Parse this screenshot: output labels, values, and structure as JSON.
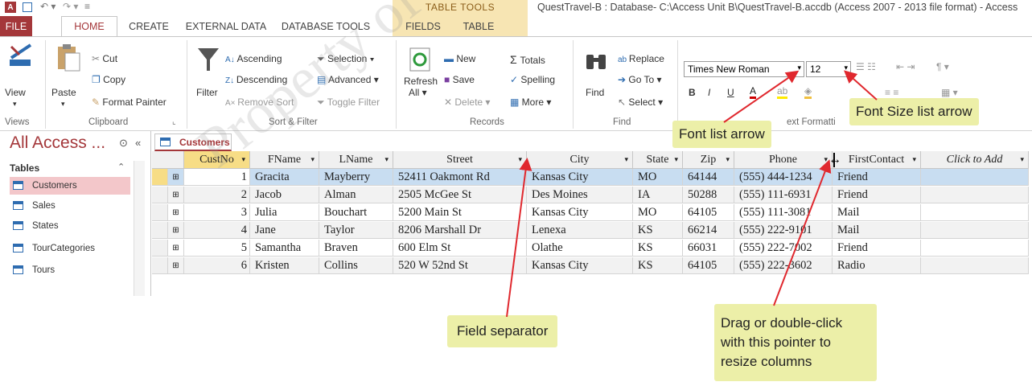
{
  "title_bar": {
    "app_icon": "A",
    "context_tab_group": "TABLE TOOLS",
    "window_title": "QuestTravel-B : Database- C:\\Access Unit B\\QuestTravel-B.accdb (Access 2007 - 2013 file format) - Access"
  },
  "tabs": [
    "FILE",
    "HOME",
    "CREATE",
    "EXTERNAL DATA",
    "DATABASE TOOLS",
    "FIELDS",
    "TABLE"
  ],
  "ribbon": {
    "views": {
      "view": "View",
      "group": "Views"
    },
    "clipboard": {
      "paste": "Paste",
      "cut": "Cut",
      "copy": "Copy",
      "format_painter": "Format Painter",
      "group": "Clipboard"
    },
    "sort_filter": {
      "filter": "Filter",
      "ascending": "Ascending",
      "descending": "Descending",
      "remove_sort": "Remove Sort",
      "selection": "Selection",
      "advanced": "Advanced",
      "toggle_filter": "Toggle Filter",
      "group": "Sort & Filter"
    },
    "records": {
      "refresh": "Refresh",
      "refresh_all": "All",
      "new": "New",
      "save": "Save",
      "delete": "Delete",
      "totals": "Totals",
      "spelling": "Spelling",
      "more": "More",
      "group": "Records"
    },
    "find": {
      "find": "Find",
      "replace": "Replace",
      "goto": "Go To",
      "select": "Select",
      "group": "Find"
    },
    "text_formatting": {
      "font": "Times New Roman",
      "size": "12",
      "bold": "B",
      "italic": "I",
      "underline": "U",
      "group_partial": "ext Formatti"
    }
  },
  "nav": {
    "title": "All Access ...",
    "section": "Tables",
    "items": [
      "Customers",
      "Sales",
      "States",
      "TourCategories",
      "Tours"
    ]
  },
  "datasheet": {
    "tab": "Customers",
    "columns": [
      "CustNo",
      "FName",
      "LName",
      "Street",
      "City",
      "State",
      "Zip",
      "Phone",
      "FirstContact",
      "Click to Add"
    ],
    "rows": [
      [
        "1",
        "Gracita",
        "Mayberry",
        "52411 Oakmont Rd",
        "Kansas City",
        "MO",
        "64144",
        "(555) 444-1234",
        "Friend"
      ],
      [
        "2",
        "Jacob",
        "Alman",
        "2505 McGee St",
        "Des Moines",
        "IA",
        "50288",
        "(555) 111-6931",
        "Friend"
      ],
      [
        "3",
        "Julia",
        "Bouchart",
        "5200 Main St",
        "Kansas City",
        "MO",
        "64105",
        "(555) 111-3081",
        "Mail"
      ],
      [
        "4",
        "Jane",
        "Taylor",
        "8206 Marshall Dr",
        "Lenexa",
        "KS",
        "66214",
        "(555) 222-9101",
        "Mail"
      ],
      [
        "5",
        "Samantha",
        "Braven",
        "600 Elm St",
        "Olathe",
        "KS",
        "66031",
        "(555) 222-7002",
        "Friend"
      ],
      [
        "6",
        "Kristen",
        "Collins",
        "520 W 52nd St",
        "Kansas City",
        "KS",
        "64105",
        "(555) 222-3602",
        "Radio"
      ]
    ]
  },
  "callouts": {
    "font_list": "Font list arrow",
    "font_size_list": "Font Size list arrow",
    "field_separator": "Field separator",
    "resize_line1": "Drag or double-click",
    "resize_line2": "with this pointer to",
    "resize_line3": "resize columns"
  },
  "watermark": "Property of Cengage",
  "colors": {
    "access_red": "#a4373a",
    "table_tools": "#f7e5b3",
    "selected_row": "#c8ddf1",
    "callout": "#ecefa8",
    "arrow": "#e0282e"
  }
}
